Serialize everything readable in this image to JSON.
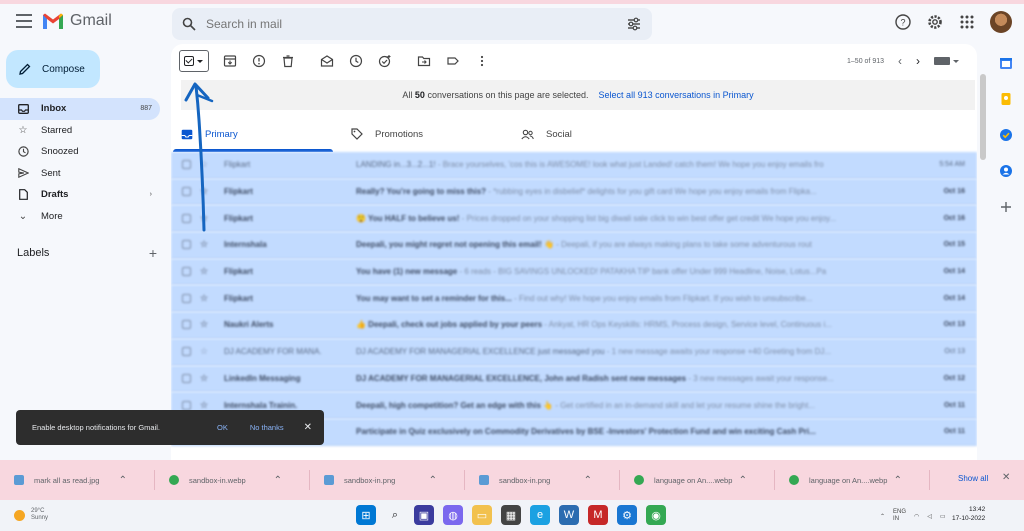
{
  "app": {
    "name": "Gmail"
  },
  "search": {
    "placeholder": "Search in mail"
  },
  "sidebar": {
    "compose_label": "Compose",
    "items": [
      {
        "label": "Inbox",
        "count": "887",
        "icon": "inbox-icon"
      },
      {
        "label": "Starred",
        "icon": "star-icon"
      },
      {
        "label": "Snoozed",
        "icon": "clock-icon"
      },
      {
        "label": "Sent",
        "icon": "send-icon"
      },
      {
        "label": "Drafts",
        "icon": "draft-icon"
      },
      {
        "label": "More",
        "icon": "chevron-down-icon"
      }
    ],
    "labels_heading": "Labels"
  },
  "toolbar": {
    "pagination": "1–50 of 913"
  },
  "banner": {
    "prefix": "All",
    "count": "50",
    "suffix": "conversations on this page are selected.",
    "select_all": "Select all 913 conversations in Primary"
  },
  "tabs": [
    {
      "label": "Primary"
    },
    {
      "label": "Promotions"
    },
    {
      "label": "Social"
    }
  ],
  "emails": [
    {
      "sender": "Flipkart",
      "subject": "LANDING in...3...2...1!",
      "snippet": " - Brace yourselves, 'cos this is AWESOME! look what just Landed! catch them! We hope you enjoy emails fro",
      "date": "5:54 AM",
      "unread": false
    },
    {
      "sender": "Flipkart",
      "subject": "Really? You're going to miss this?",
      "snippet": " - *rubbing eyes in disbelief* delights for you gift card We hope you enjoy emails from Flipka...",
      "date": "Oct 16",
      "unread": true
    },
    {
      "sender": "Flipkart",
      "subject": "😲 You HALF to believe us!",
      "snippet": " - Prices dropped on your shopping list big diwali sale click to win best offer get credit We hope you enjoy...",
      "date": "Oct 16",
      "unread": true
    },
    {
      "sender": "Internshala",
      "subject": "Deepali, you might regret not opening this email! 👋",
      "snippet": " - Deepali, if you are always making plans to take some adventurous rout",
      "date": "Oct 15",
      "unread": true
    },
    {
      "sender": "Flipkart",
      "subject": "You have (1) new message",
      "snippet": " - 6 reads - BIG SAVINGS UNLOCKED! PATAKHA TIP bank offer Under 999 Headline, Noise, Lotus...Pa",
      "date": "Oct 14",
      "unread": true
    },
    {
      "sender": "Flipkart",
      "subject": "You may want to set a reminder for this...",
      "snippet": " - Find out why! We hope you enjoy emails from Flipkart. If you wish to unsubscribe...",
      "date": "Oct 14",
      "unread": true
    },
    {
      "sender": "Naukri Alerts",
      "subject": "👍 Deepali, check out jobs applied by your peers",
      "snippet": " - Ankyat, HR Ops Keyskills: HRMS, Process design, Service level, Continuous i...",
      "date": "Oct 13",
      "unread": true
    },
    {
      "sender": "DJ ACADEMY FOR MANA.",
      "subject": "DJ ACADEMY FOR MANAGERIAL EXCELLENCE just messaged you",
      "snippet": " - 1 new message awaits your response +40 Greeting from DJ...",
      "date": "Oct 13",
      "unread": false
    },
    {
      "sender": "LinkedIn Messaging",
      "subject": "DJ ACADEMY FOR MANAGERIAL EXCELLENCE, John and Radish sent new messages",
      "snippet": " - 3 new messages await your response...",
      "date": "Oct 12",
      "unread": true
    },
    {
      "sender": "Internshala Trainin.",
      "subject": "Deepali, high competition? Get an edge with this 👆",
      "snippet": " - Get certified in an in-demand skill and let your resume shine the bright...",
      "date": "Oct 11",
      "unread": true
    },
    {
      "sender": "",
      "subject": "Participate in Quiz exclusively on Commodity Derivatives by BSE -Investors' Protection Fund and win exciting Cash Pri...",
      "snippet": "",
      "date": "Oct 11",
      "unread": true
    }
  ],
  "toast": {
    "message": "Enable desktop notifications for Gmail.",
    "ok": "OK",
    "no_thanks": "No thanks"
  },
  "downloads": {
    "items": [
      {
        "name": "mark all as read.jpg",
        "icon": "image-file-icon",
        "color": "#5b9bd5"
      },
      {
        "name": "sandbox-in.webp",
        "icon": "chrome-icon",
        "color": "#34a853"
      },
      {
        "name": "sandbox-in.png",
        "icon": "image-file-icon",
        "color": "#5b9bd5"
      },
      {
        "name": "sandbox-in.png",
        "icon": "image-file-icon",
        "color": "#5b9bd5"
      },
      {
        "name": "language on An....webp",
        "icon": "chrome-icon",
        "color": "#34a853"
      },
      {
        "name": "language on An....webp",
        "icon": "chrome-icon",
        "color": "#34a853"
      }
    ],
    "show_all": "Show all"
  },
  "taskbar": {
    "weather_temp": "29°C",
    "weather_desc": "Sunny",
    "lang": "ENG\nIN",
    "time": "13:42",
    "date": "17-10-2022"
  }
}
